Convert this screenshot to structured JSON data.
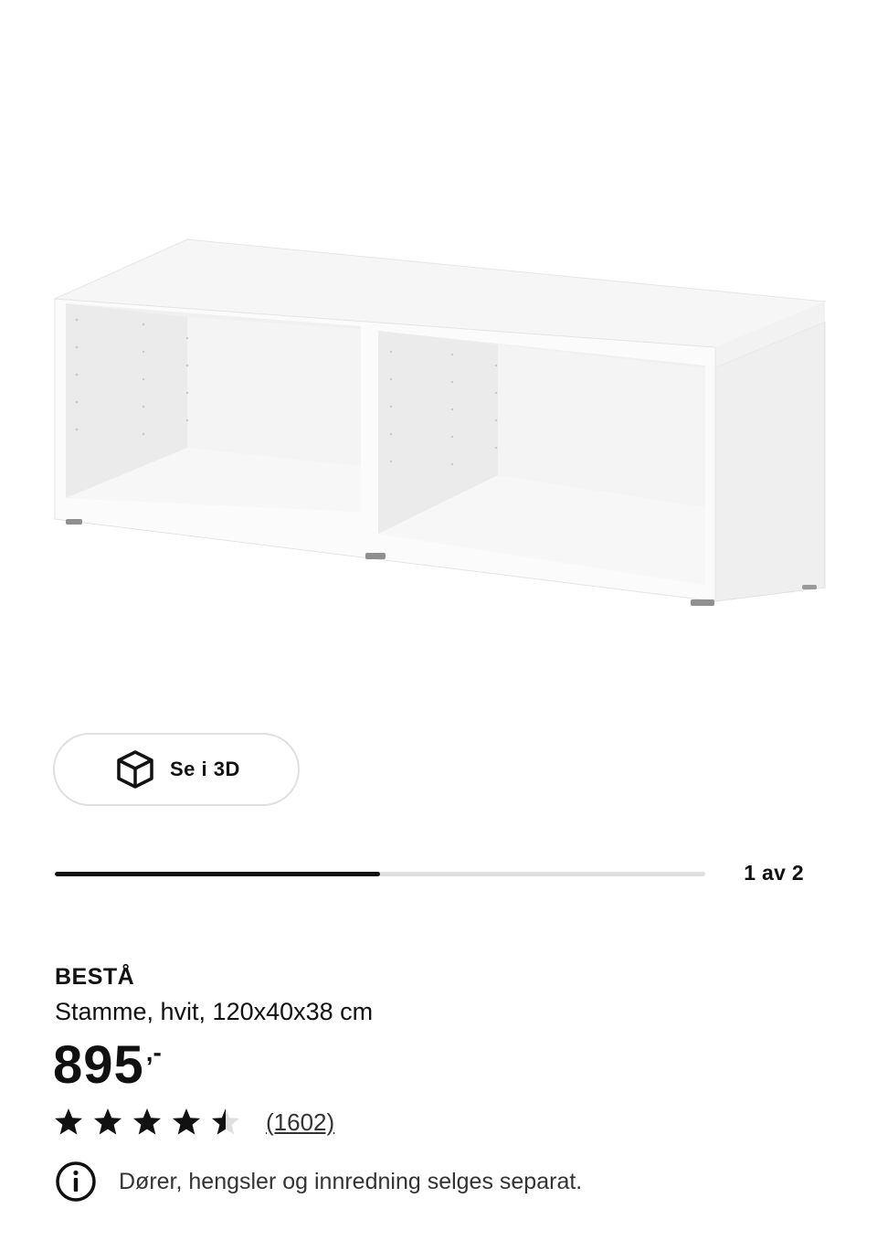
{
  "gallery": {
    "image_alt": "Stamme, hvit",
    "view_3d_label": "Se i 3D",
    "view_3d_icon": "cube-icon",
    "progress": 0.5,
    "pager_text": "1 av 2"
  },
  "product": {
    "name": "BESTÅ",
    "description": "Stamme, hvit, 120x40x38 cm",
    "price": "895",
    "price_suffix": ",-",
    "rating": 4.5,
    "rating_max": 5,
    "review_count": "(1602)",
    "notice_icon": "info-icon",
    "notice": "Dører, hengsler og innredning selges separat."
  },
  "colors": {
    "text": "#111111",
    "progress_track": "#dfdfdf",
    "progress_fill": "#111111",
    "star_filled": "#111111",
    "star_empty": "#dfdfdf"
  }
}
